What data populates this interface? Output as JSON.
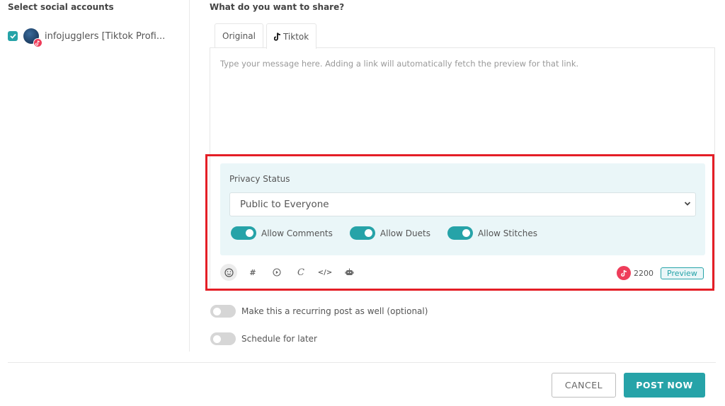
{
  "left": {
    "title": "Select social accounts",
    "accounts": [
      {
        "name": "infojugglers [Tiktok Profi...",
        "checked": true,
        "platform": "tiktok-icon"
      }
    ]
  },
  "composer": {
    "title": "What do you want to share?",
    "tabs": [
      {
        "label": "Original",
        "active": false
      },
      {
        "label": "Tiktok",
        "active": true,
        "icon": "tiktok-icon"
      }
    ],
    "message_placeholder": "Type your message here. Adding a link will automatically fetch the preview for that link.",
    "message_value": ""
  },
  "privacy": {
    "label": "Privacy Status",
    "selected": "Public to Everyone",
    "toggles": [
      {
        "label": "Allow Comments",
        "on": true
      },
      {
        "label": "Allow Duets",
        "on": true
      },
      {
        "label": "Allow Stitches",
        "on": true
      }
    ]
  },
  "toolbar": {
    "tools": [
      "emoji-icon",
      "hashtag-icon",
      "media-icon",
      "caption-icon",
      "code-icon",
      "ai-robot-icon"
    ],
    "char_count": "2200",
    "preview_label": "Preview"
  },
  "options": {
    "recurring_label": "Make this a recurring post as well (optional)",
    "recurring_on": false,
    "schedule_label": "Schedule for later",
    "schedule_on": false
  },
  "footer": {
    "cancel_label": "CANCEL",
    "post_label": "POST NOW"
  },
  "colors": {
    "accent": "#26a3a8",
    "tiktok": "#ee3d5a",
    "highlight": "#e41e26",
    "panel_bg": "#eaf6f8"
  }
}
